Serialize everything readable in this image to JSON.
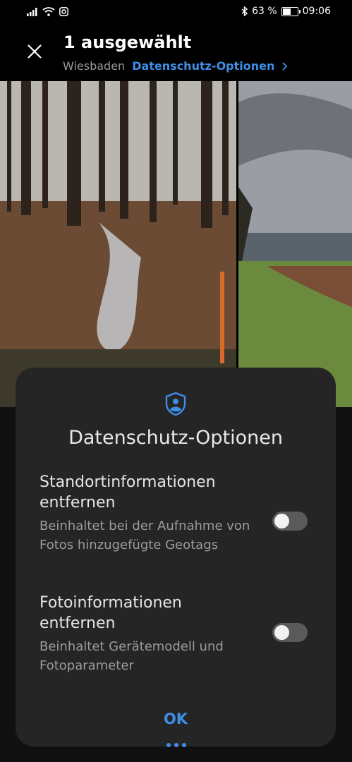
{
  "status_bar": {
    "battery_percent": "63 %",
    "time": "09:06",
    "battery_level": 0.63,
    "icons": [
      "signal-icon",
      "wifi-icon",
      "instagram-icon",
      "bluetooth-icon",
      "battery-icon"
    ]
  },
  "header": {
    "title": "1 ausgewählt",
    "location": "Wiesbaden",
    "privacy_link": "Datenschutz-Optionen",
    "close_icon": "close-icon",
    "chevron_icon": "chevron-right-icon"
  },
  "photos": [
    {
      "subject": "forest-stream"
    },
    {
      "subject": "field-landscape"
    }
  ],
  "dialog": {
    "icon": "shield-person-icon",
    "title": "Datenschutz-Optionen",
    "options": [
      {
        "title": "Standortinformationen entfernen",
        "description": "Beinhaltet bei der Aufnahme von Fotos hinzugefügte Geotags",
        "enabled": false
      },
      {
        "title": "Fotoinformationen entfernen",
        "description": "Beinhaltet Gerätemodell und Fotoparameter",
        "enabled": false
      }
    ],
    "ok_label": "OK"
  },
  "colors": {
    "accent": "#3f8ee8",
    "dialog_bg": "#252525",
    "toggle_off": "#5a5a5a"
  }
}
